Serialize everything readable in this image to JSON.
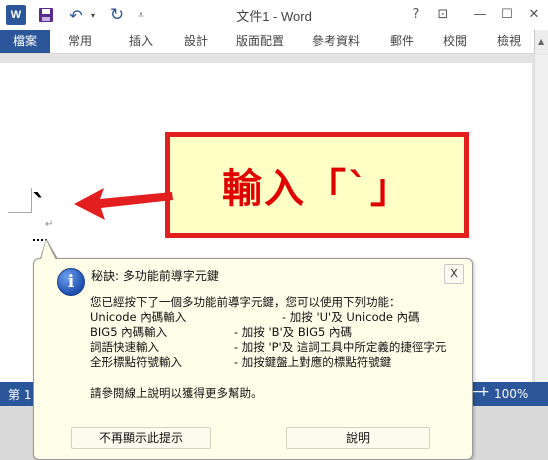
{
  "window": {
    "title": "文件1 - Word",
    "app_icon": "W",
    "help_label": "?",
    "ribbon_options_label": "⊡",
    "minimize_label": "—",
    "maximize_label": "☐",
    "close_label": "✕",
    "accent": "#2b579a"
  },
  "quick_access": {
    "undo_label": "↶",
    "undo_dropdown_label": "▾",
    "redo_label": "↻",
    "customize_label": "⩡"
  },
  "ribbon": {
    "tabs": [
      {
        "label": "檔案",
        "active": true
      },
      {
        "label": "常用"
      },
      {
        "label": "插入"
      },
      {
        "label": "設計"
      },
      {
        "label": "版面配置"
      },
      {
        "label": "參考資料"
      },
      {
        "label": "郵件"
      },
      {
        "label": "校閱"
      },
      {
        "label": "檢視"
      }
    ],
    "scroll_label": "▲"
  },
  "document": {
    "typed_char": "`",
    "paragraph_mark": "↵"
  },
  "callout": {
    "text": "輸入「`」",
    "border_color": "#e31e1e",
    "fill_color": "#ffffc6",
    "text_color": "#e00000"
  },
  "status": {
    "page_label": "第 1",
    "zoom_minus": "−",
    "zoom_plus": "+",
    "zoom_level": "100%"
  },
  "tooltip": {
    "title": "秘訣: 多功能前導字元鍵",
    "close_label": "X",
    "intro": "您已經按下了一個多功能前導字元鍵，您可以使用下列功能：",
    "features": [
      {
        "name": "Unicode 內碼輸入",
        "action": "- 加按 'U'及 Unicode 內碼"
      },
      {
        "name": "BIG5 內碼輸入",
        "action": "- 加按 'B'及 BIG5 內碼"
      },
      {
        "name": "詞語快速輸入",
        "action": "- 加按 'P'及 這詞工具中所定義的捷徑字元"
      },
      {
        "name": "全形標點符號輸入",
        "action": "- 加按鍵盤上對應的標點符號鍵"
      }
    ],
    "footer": "請參閱線上說明以獲得更多幫助。",
    "buttons": {
      "dont_show": "不再顯示此提示",
      "help": "說明"
    },
    "icon": "info-icon"
  }
}
